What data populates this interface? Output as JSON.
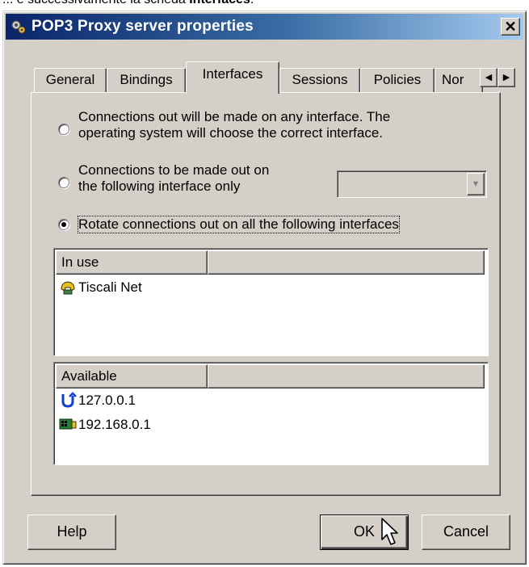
{
  "caption": {
    "prefix": "... e successivamente la scheda ",
    "bold": "Interfaces",
    "suffix": "."
  },
  "window": {
    "title": "POP3 Proxy server properties",
    "close_label": "✕"
  },
  "tabs": [
    {
      "label": "General",
      "active": false
    },
    {
      "label": "Bindings",
      "active": false
    },
    {
      "label": "Interfaces",
      "active": true
    },
    {
      "label": "Sessions",
      "active": false
    },
    {
      "label": "Policies",
      "active": false
    },
    {
      "label": "Nor",
      "active": false
    }
  ],
  "tab_scroll": {
    "left": "◀",
    "right": "▶"
  },
  "options": {
    "any_interface": {
      "line1": "Connections out will be made on any interface.  The",
      "line2": "operating system will choose the correct interface.",
      "checked": false
    },
    "single_interface": {
      "line1": "Connections to be made out on",
      "line2": "the following interface only",
      "checked": false,
      "combo_value": ""
    },
    "rotate": {
      "label": "Rotate connections out on all the following interfaces",
      "checked": true
    }
  },
  "in_use": {
    "header": "In use",
    "items": [
      {
        "label": "Tiscali Net",
        "icon": "dialup-phone-icon"
      }
    ]
  },
  "available": {
    "header": "Available",
    "items": [
      {
        "label": "127.0.0.1",
        "icon": "loopback-icon"
      },
      {
        "label": "192.168.0.1",
        "icon": "network-card-icon"
      }
    ]
  },
  "buttons": {
    "help": "Help",
    "ok": "OK",
    "cancel": "Cancel"
  },
  "colors": {
    "face": "#d4d0c8",
    "title_start": "#0a246a",
    "title_end": "#a6caf0"
  }
}
